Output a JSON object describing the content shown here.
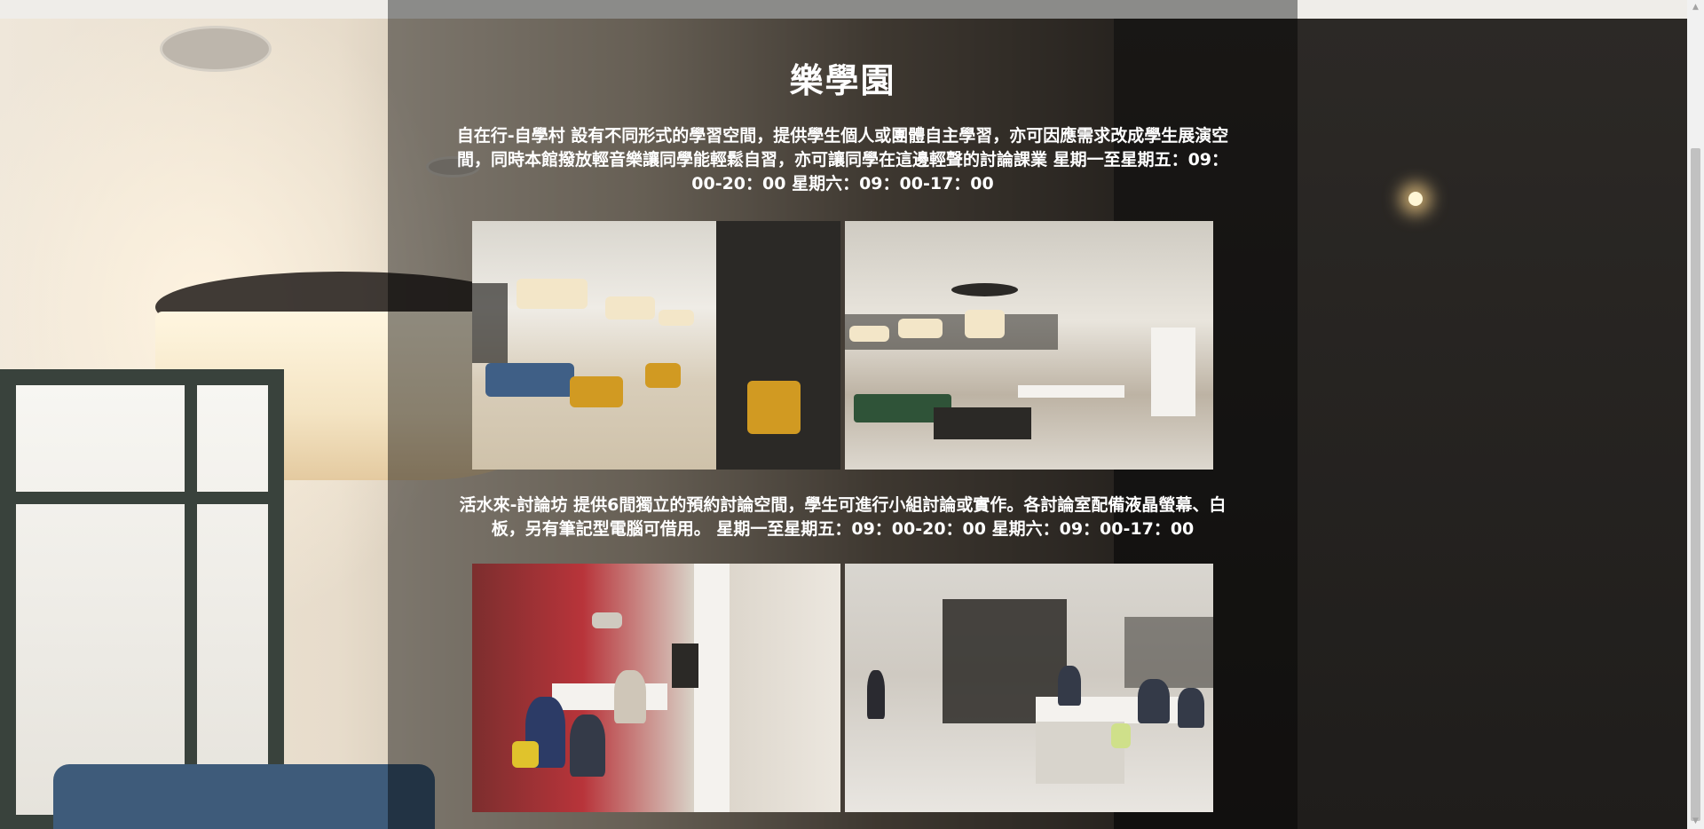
{
  "section": {
    "title": "樂學園",
    "intro": "自在行-自學村 設有不同形式的學習空間，提供學生個人或團體自主學習，亦可因應需求改成學生展演空間，同時本館撥放輕音樂讓同學能輕鬆自習，亦可讓同學在這邊輕聲的討論課業 星期一至星期五：09：00-20：00 星期六：09：00-17：00",
    "discussion": "活水來-討論坊 提供6間獨立的預約討論空間，學生可進行小組討論或實作。各討論室配備液晶螢幕、白板，另有筆記型電腦可借用。 星期一至星期五：09：00-20：00 星期六：09：00-17：00"
  },
  "photos": {
    "study_area_1": "study-lounge-photo",
    "study_area_2": "open-study-hall-photo",
    "discussion_room_1": "discussion-room-group-photo",
    "discussion_room_2": "discussion-room-glass-photo"
  },
  "scrollbar": {
    "up": "▲",
    "down": "▼"
  }
}
